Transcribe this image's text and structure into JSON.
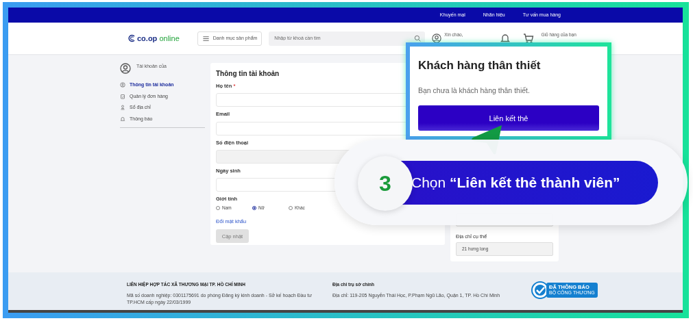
{
  "top_bar": {
    "links": [
      "Khuyến mại",
      "Nhãn hiệu",
      "Tư vấn mua hàng"
    ]
  },
  "header": {
    "logo": {
      "brand": "co.op",
      "suffix": "online"
    },
    "category_button": "Danh mục sản phẩm",
    "search": {
      "placeholder": "Nhập từ khoá cần tìm"
    },
    "greeting": "Xin chào,",
    "cart": "Giỏ hàng của bạn"
  },
  "sidebar": {
    "account": "Tài khoản của",
    "items": [
      {
        "label": "Thông tin tài khoản",
        "selected": true
      },
      {
        "label": "Quản lý đơn hàng",
        "selected": false
      },
      {
        "label": "Sổ địa chỉ",
        "selected": false
      },
      {
        "label": "Thông báo",
        "selected": false
      }
    ]
  },
  "form": {
    "title": "Thông tin tài khoản",
    "fields": [
      {
        "label": "Họ tên",
        "required_mark": "*",
        "disabled": false
      },
      {
        "label": "Email",
        "disabled": false
      },
      {
        "label": "Số điện thoại",
        "disabled": true
      },
      {
        "label": "Ngày sinh",
        "disabled": false
      }
    ],
    "gender": {
      "label": "Giới tính",
      "options": [
        {
          "label": "Nam",
          "selected": false
        },
        {
          "label": "Nữ",
          "selected": true
        },
        {
          "label": "Khác",
          "selected": false
        }
      ]
    },
    "change_password": "Đổi mật khẩu",
    "submit": {
      "label": "Cập nhật",
      "disabled": true
    }
  },
  "address_card": {
    "label": "Địa chỉ cụ thể",
    "value": "21 hưng long"
  },
  "popup": {
    "title": "Khách hàng thân thiết",
    "message": "Bạn chưa là khách hàng thân thiết.",
    "button": "Liên kết thẻ"
  },
  "callout": {
    "step": "3",
    "text": "Chọn **“Liên kết thẻ thành viên”**"
  },
  "footer": {
    "company": "LIÊN HIỆP HỢP TÁC XÃ THƯƠNG MẠI TP. HỒ CHÍ MINH",
    "registration": "Mã số doanh nghiệp: 0301175691 do phòng Đăng ký kinh doanh - Sở kế hoạch Đầu tư TP.HCM cấp ngày 22/03/1999",
    "address_title": "Địa chỉ trụ sở chính",
    "address": "Địa chỉ: 119-205 Nguyễn Thái Học, P.Phạm Ngũ Lão, Quận 1, TP. Hồ Chí Minh",
    "badge": {
      "title": "ĐÃ THÔNG BÁO",
      "subtitle": "BỘ CÔNG THƯƠNG"
    }
  }
}
